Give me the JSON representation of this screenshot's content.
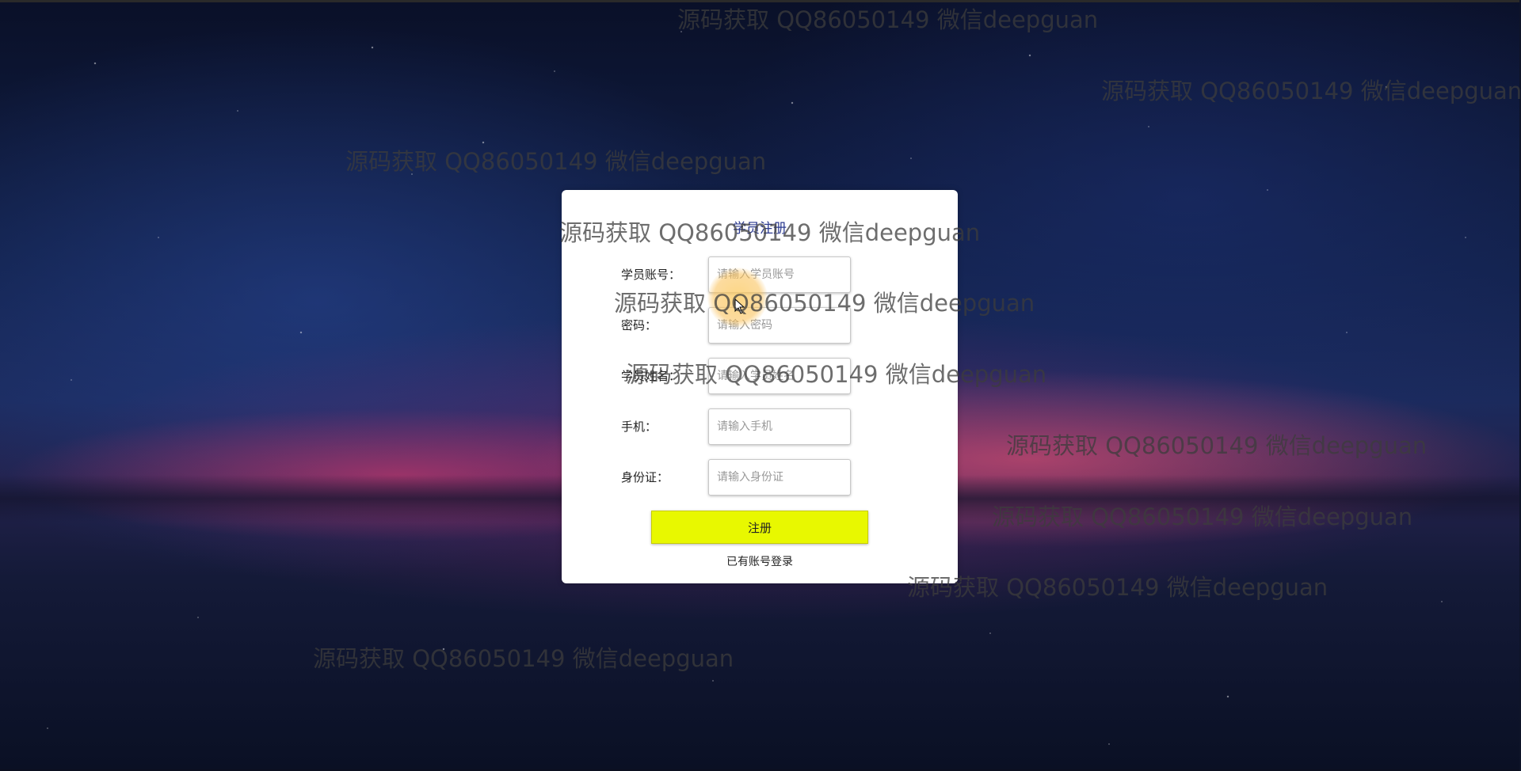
{
  "form": {
    "title": "学员注册",
    "fields": [
      {
        "label": "学员账号：",
        "placeholder": "请输入学员账号"
      },
      {
        "label": "密码：",
        "placeholder": "请输入密码"
      },
      {
        "label": "学员姓名：",
        "placeholder": "请输入学员姓名"
      },
      {
        "label": "手机：",
        "placeholder": "请输入手机"
      },
      {
        "label": "身份证：",
        "placeholder": "请输入身份证"
      }
    ],
    "submit_label": "注册",
    "login_link": "已有账号登录"
  },
  "watermark_text": "源码获取 QQ86050149 微信deepguan",
  "colors": {
    "submit_button": "#e8f800",
    "title": "#2b3a8f"
  }
}
